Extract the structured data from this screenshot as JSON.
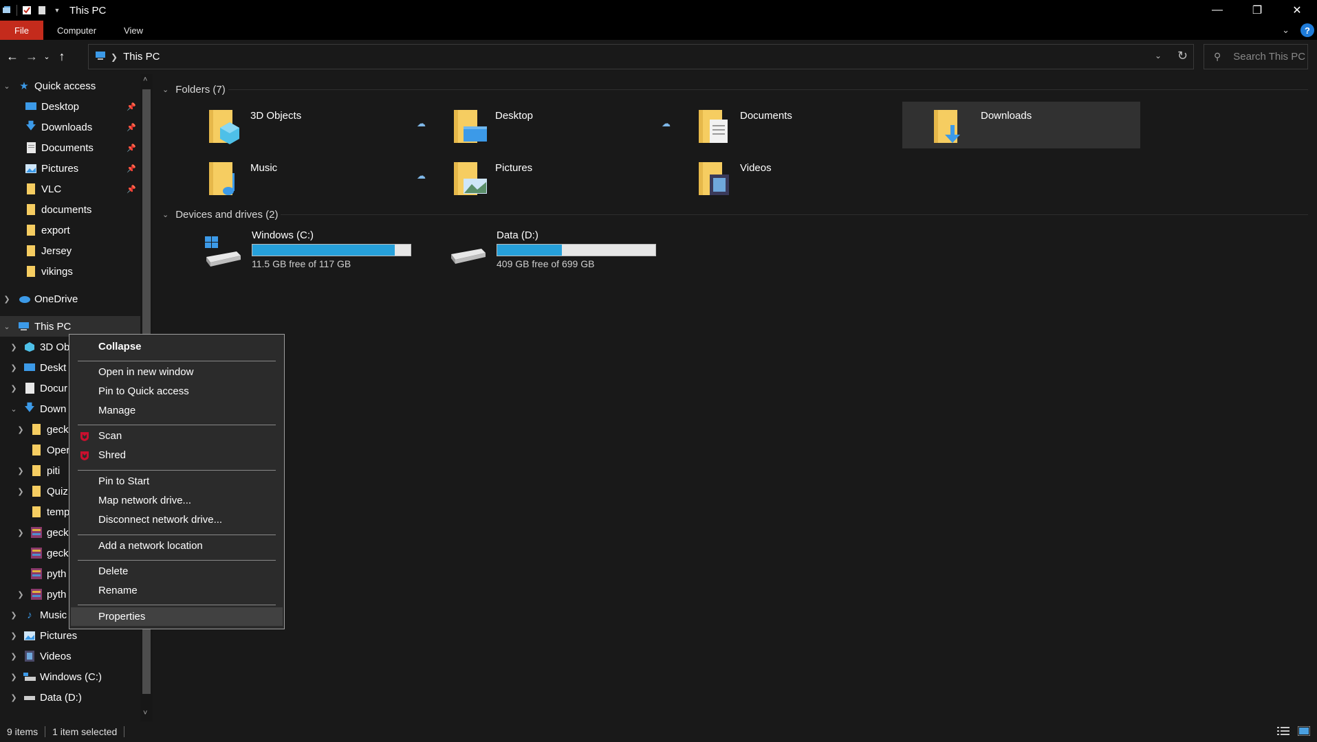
{
  "window": {
    "title": "This PC",
    "controls": [
      "minimize",
      "restore",
      "close"
    ]
  },
  "ribbon": {
    "tabs": [
      {
        "label": "File"
      },
      {
        "label": "Computer"
      },
      {
        "label": "View"
      }
    ]
  },
  "address": {
    "path": "This PC",
    "search_placeholder": "Search This PC"
  },
  "sidebar": {
    "quick_access": {
      "label": "Quick access"
    },
    "quick_items": [
      {
        "label": "Desktop",
        "icon": "desktop-icon",
        "pinned": true
      },
      {
        "label": "Downloads",
        "icon": "downloads-icon",
        "pinned": true
      },
      {
        "label": "Documents",
        "icon": "documents-icon",
        "pinned": true
      },
      {
        "label": "Pictures",
        "icon": "pictures-icon",
        "pinned": true
      },
      {
        "label": "VLC",
        "icon": "folder-icon",
        "pinned": true
      },
      {
        "label": "documents",
        "icon": "folder-icon",
        "pinned": false
      },
      {
        "label": "export",
        "icon": "folder-icon",
        "pinned": false
      },
      {
        "label": "Jersey",
        "icon": "folder-icon",
        "pinned": false
      },
      {
        "label": "vikings",
        "icon": "folder-icon",
        "pinned": false
      }
    ],
    "onedrive": {
      "label": "OneDrive"
    },
    "this_pc": {
      "label": "This PC"
    },
    "pc_items": [
      {
        "label": "3D Ob"
      },
      {
        "label": "Deskt"
      },
      {
        "label": "Docur"
      },
      {
        "label": "Down"
      },
      {
        "label": "geck"
      },
      {
        "label": "Oper"
      },
      {
        "label": "piti"
      },
      {
        "label": "Quiz"
      },
      {
        "label": "temp"
      },
      {
        "label": "geck"
      },
      {
        "label": "geck"
      },
      {
        "label": "pyth"
      },
      {
        "label": "pyth"
      },
      {
        "label": "Music"
      },
      {
        "label": "Pictures"
      },
      {
        "label": "Videos"
      },
      {
        "label": "Windows (C:)"
      },
      {
        "label": "Data (D:)"
      }
    ]
  },
  "content": {
    "folders_header": "Folders (7)",
    "folders": [
      {
        "name": "3D Objects",
        "icon": "3d-objects-folder-icon"
      },
      {
        "name": "Desktop",
        "icon": "desktop-folder-icon"
      },
      {
        "name": "Documents",
        "icon": "documents-folder-icon"
      },
      {
        "name": "Downloads",
        "icon": "downloads-folder-icon"
      },
      {
        "name": "Music",
        "icon": "music-folder-icon"
      },
      {
        "name": "Pictures",
        "icon": "pictures-folder-icon"
      },
      {
        "name": "Videos",
        "icon": "videos-folder-icon"
      }
    ],
    "drives_header": "Devices and drives (2)",
    "drives": [
      {
        "name": "Windows (C:)",
        "free": "11.5 GB free of 117 GB",
        "used_fraction": 0.9
      },
      {
        "name": "Data (D:)",
        "free": "409 GB free of 699 GB",
        "used_fraction": 0.41
      }
    ]
  },
  "context_menu": {
    "items": [
      {
        "label": "Collapse"
      },
      {
        "label": "Open in new window"
      },
      {
        "label": "Pin to Quick access"
      },
      {
        "label": "Manage"
      },
      {
        "label": "Scan"
      },
      {
        "label": "Shred"
      },
      {
        "label": "Pin to Start"
      },
      {
        "label": "Map network drive..."
      },
      {
        "label": "Disconnect network drive..."
      },
      {
        "label": "Add a network location"
      },
      {
        "label": "Delete"
      },
      {
        "label": "Rename"
      },
      {
        "label": "Properties"
      }
    ]
  },
  "status": {
    "items_count": "9 items",
    "selection": "1 item selected"
  },
  "colors": {
    "accent": "#26a0da",
    "file_tab": "#c42b1c",
    "background": "#191919",
    "menu_bg": "#2b2b2b"
  }
}
